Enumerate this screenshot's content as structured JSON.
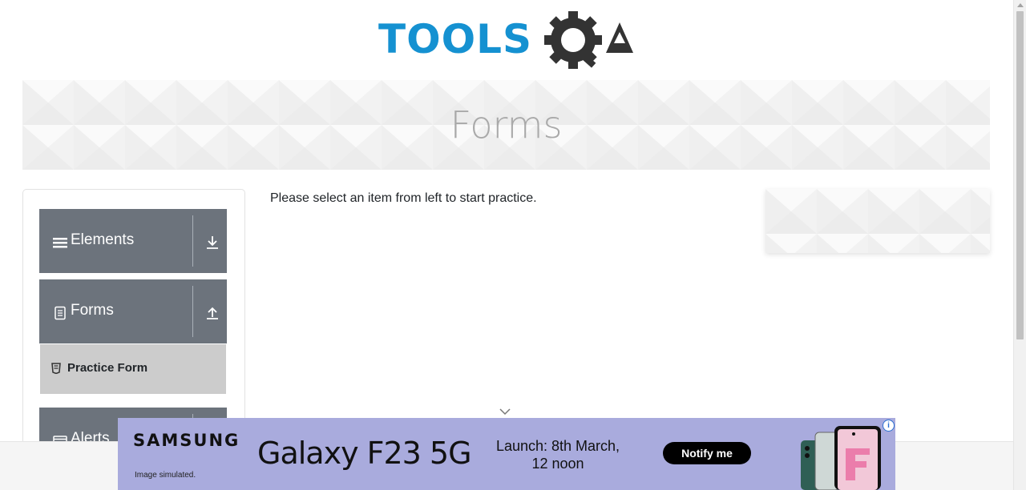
{
  "logo": {
    "text_part": "TOOLS",
    "gear_part": "Q",
    "suffix": "A"
  },
  "banner": {
    "title": "Forms"
  },
  "sidebar": {
    "groups": [
      {
        "label": "Elements",
        "toggle": "expand"
      },
      {
        "label": "Forms",
        "toggle": "collapse",
        "items": [
          {
            "label": "Practice Form"
          }
        ]
      },
      {
        "label": "Alerts"
      }
    ]
  },
  "main": {
    "instruction": "Please select an item from left to start practice."
  },
  "ad": {
    "brand": "SAMSUNG",
    "disclaimer": "Image simulated.",
    "product": "Galaxy F23 5G",
    "launch_line1": "Launch: 8th March,",
    "launch_line2": "12 noon",
    "cta": "Notify me",
    "info_glyph": "i"
  },
  "colors": {
    "accent_blue": "#1591d1",
    "sidebar_header": "#6c737c",
    "sub_item_active": "#cccccc"
  }
}
